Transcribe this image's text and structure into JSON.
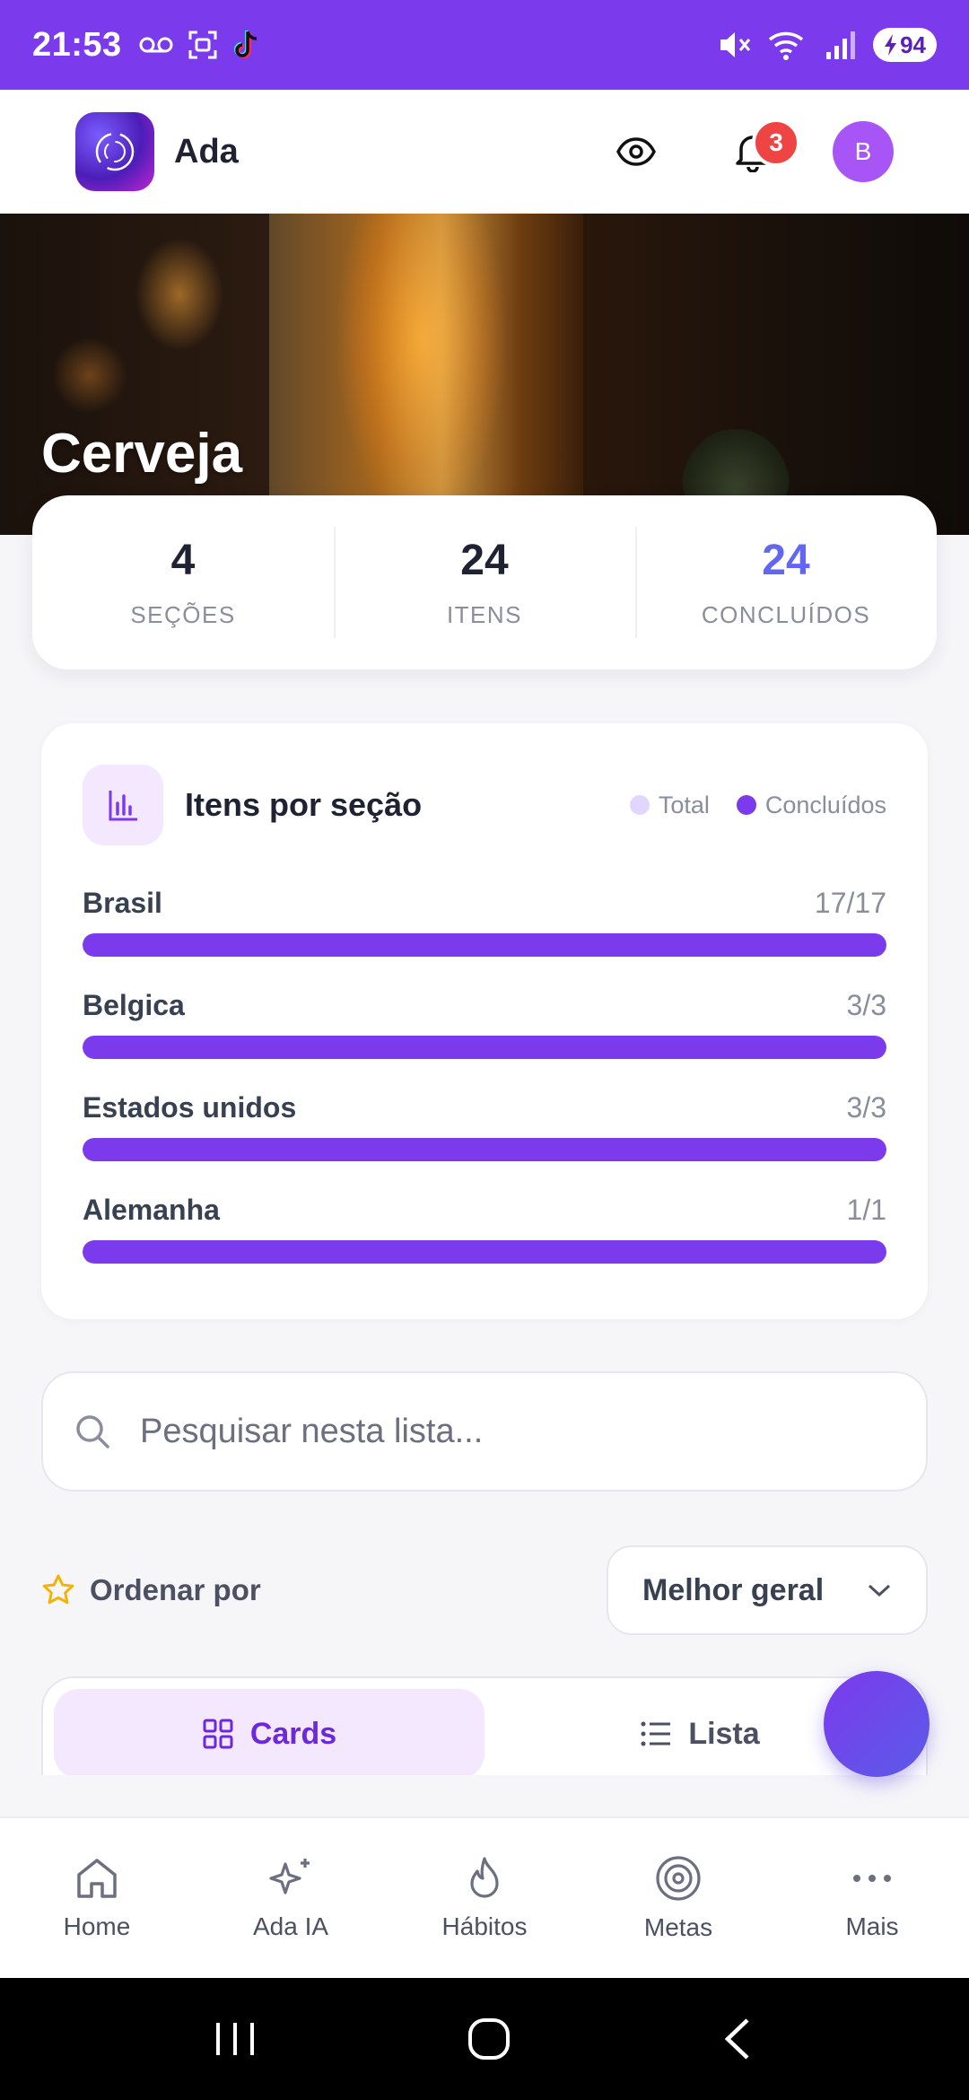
{
  "status_bar": {
    "time": "21:53",
    "battery": "94"
  },
  "header": {
    "app_name": "Ada",
    "notification_count": "3",
    "avatar_initial": "B"
  },
  "hero": {
    "title": "Cerveja"
  },
  "stats": [
    {
      "value": "4",
      "label": "SEÇÕES"
    },
    {
      "value": "24",
      "label": "ITENS"
    },
    {
      "value": "24",
      "label": "CONCLUÍDOS"
    }
  ],
  "chart_card": {
    "title": "Itens por seção",
    "legend": {
      "total": "Total",
      "completed": "Concluídos"
    }
  },
  "chart_data": {
    "type": "bar",
    "categories": [
      "Brasil",
      "Belgica",
      "Estados unidos",
      "Alemanha"
    ],
    "count_labels": [
      "17/17",
      "3/3",
      "3/3",
      "1/1"
    ],
    "series": [
      {
        "name": "Total",
        "values": [
          17,
          3,
          3,
          1
        ]
      },
      {
        "name": "Concluídos",
        "values": [
          17,
          3,
          3,
          1
        ]
      }
    ],
    "colors": {
      "total": "#ede4ff",
      "completed": "#7c3aed"
    }
  },
  "search": {
    "placeholder": "Pesquisar nesta lista...",
    "value": ""
  },
  "sort": {
    "label": "Ordenar por",
    "selected": "Melhor geral"
  },
  "view_toggle": {
    "cards": "Cards",
    "list": "Lista"
  },
  "bottom_nav": [
    {
      "label": "Home",
      "icon": "home-icon"
    },
    {
      "label": "Ada IA",
      "icon": "sparkles-icon"
    },
    {
      "label": "Hábitos",
      "icon": "flame-icon"
    },
    {
      "label": "Metas",
      "icon": "target-icon"
    },
    {
      "label": "Mais",
      "icon": "more-icon"
    }
  ],
  "colors": {
    "accent": "#7c3aed",
    "status_bar": "#7c3aed",
    "badge": "#ef4444",
    "completed_stat": "#6366f1"
  }
}
